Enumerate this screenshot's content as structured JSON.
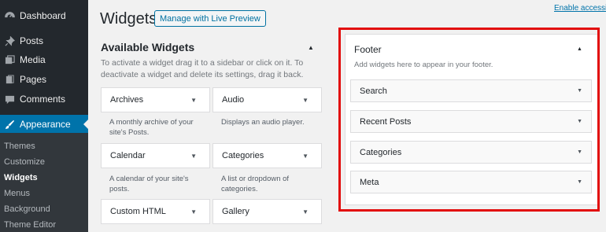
{
  "sidebar": {
    "items": [
      {
        "label": "Dashboard",
        "icon": "dashboard-icon"
      },
      {
        "label": "Posts",
        "icon": "pin-icon"
      },
      {
        "label": "Media",
        "icon": "media-icon"
      },
      {
        "label": "Pages",
        "icon": "pages-icon"
      },
      {
        "label": "Comments",
        "icon": "comment-icon"
      },
      {
        "label": "Appearance",
        "icon": "brush-icon",
        "active": true
      }
    ],
    "submenu": [
      {
        "label": "Themes"
      },
      {
        "label": "Customize"
      },
      {
        "label": "Widgets",
        "current": true
      },
      {
        "label": "Menus"
      },
      {
        "label": "Background"
      },
      {
        "label": "Theme Editor"
      }
    ]
  },
  "header": {
    "title": "Widgets",
    "manage_button": "Manage with Live Preview",
    "accessibility_link": "Enable accessibi"
  },
  "available": {
    "title": "Available Widgets",
    "description": "To activate a widget drag it to a sidebar or click on it. To deactivate a widget and delete its settings, drag it back.",
    "widgets": [
      {
        "label": "Archives",
        "description": "A monthly archive of your site's Posts."
      },
      {
        "label": "Audio",
        "description": "Displays an audio player."
      },
      {
        "label": "Calendar",
        "description": "A calendar of your site's posts."
      },
      {
        "label": "Categories",
        "description": "A list or dropdown of categories."
      },
      {
        "label": "Custom HTML",
        "description": ""
      },
      {
        "label": "Gallery",
        "description": ""
      }
    ]
  },
  "footer_area": {
    "title": "Footer",
    "description": "Add widgets here to appear in your footer.",
    "widgets": [
      {
        "label": "Search"
      },
      {
        "label": "Recent Posts"
      },
      {
        "label": "Categories"
      },
      {
        "label": "Meta"
      }
    ]
  },
  "colors": {
    "sidebar_bg": "#23282d",
    "active": "#0073aa",
    "highlight": "#e20c0c"
  }
}
